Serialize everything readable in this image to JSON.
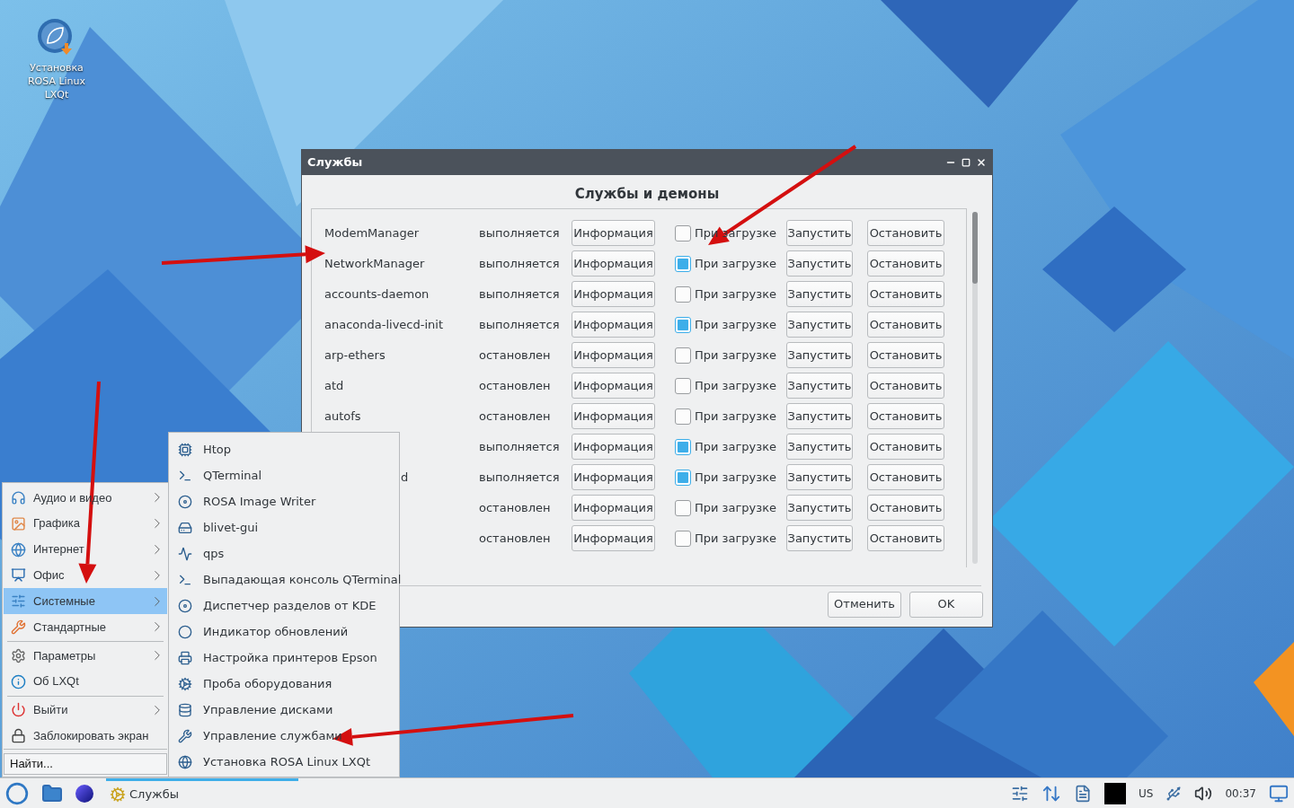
{
  "desktop_icons": [
    {
      "label": "Установка ROSA Linux LXQt"
    }
  ],
  "dialog": {
    "title": "Службы",
    "heading": "Службы и демоны",
    "services": [
      {
        "name": "ModemManager",
        "status": "выполняется",
        "info": "Информация",
        "autostart_label": "При загрузке",
        "autostart": false,
        "start": "Запустить",
        "stop": "Остановить"
      },
      {
        "name": "NetworkManager",
        "status": "выполняется",
        "info": "Информация",
        "autostart_label": "При загрузке",
        "autostart": true,
        "start": "Запустить",
        "stop": "Остановить"
      },
      {
        "name": "accounts-daemon",
        "status": "выполняется",
        "info": "Информация",
        "autostart_label": "При загрузке",
        "autostart": false,
        "start": "Запустить",
        "stop": "Остановить"
      },
      {
        "name": "anaconda-livecd-init",
        "status": "выполняется",
        "info": "Информация",
        "autostart_label": "При загрузке",
        "autostart": true,
        "start": "Запустить",
        "stop": "Остановить"
      },
      {
        "name": "arp-ethers",
        "status": "остановлен",
        "info": "Информация",
        "autostart_label": "При загрузке",
        "autostart": false,
        "start": "Запустить",
        "stop": "Остановить"
      },
      {
        "name": "atd",
        "status": "остановлен",
        "info": "Информация",
        "autostart_label": "При загрузке",
        "autostart": false,
        "start": "Запустить",
        "stop": "Остановить"
      },
      {
        "name": "autofs",
        "status": "остановлен",
        "info": "Информация",
        "autostart_label": "При загрузке",
        "autostart": false,
        "start": "Запустить",
        "stop": "Остановить"
      },
      {
        "status": "выполняется",
        "info": "Информация",
        "autostart_label": "При загрузке",
        "autostart": true,
        "start": "Запустить",
        "stop": "Остановить"
      },
      {
        "name_tail": "d",
        "status": "выполняется",
        "info": "Информация",
        "autostart_label": "При загрузке",
        "autostart": true,
        "start": "Запустить",
        "stop": "Остановить"
      },
      {
        "status": "остановлен",
        "info": "Информация",
        "autostart_label": "При загрузке",
        "autostart": false,
        "start": "Запустить",
        "stop": "Остановить"
      },
      {
        "status": "остановлен",
        "info": "Информация",
        "autostart_label": "При загрузке",
        "autostart": false,
        "start": "Запустить",
        "stop": "Остановить"
      }
    ],
    "buttons": [
      "Отменить",
      "OK"
    ]
  },
  "menu": {
    "items": [
      {
        "kind": "item",
        "label": "Аудио и видео",
        "submenu": true,
        "selected": false
      },
      {
        "kind": "item",
        "label": "Графика",
        "submenu": true,
        "selected": false
      },
      {
        "kind": "item",
        "label": "Интернет",
        "submenu": true,
        "selected": false
      },
      {
        "kind": "item",
        "label": "Офис",
        "submenu": true,
        "selected": false
      },
      {
        "kind": "item",
        "label": "Системные",
        "submenu": true,
        "selected": true
      },
      {
        "kind": "item",
        "label": "Стандартные",
        "submenu": true,
        "selected": false
      },
      {
        "kind": "separator"
      },
      {
        "kind": "item",
        "label": "Параметры",
        "submenu": true,
        "selected": false
      },
      {
        "kind": "item",
        "label": "Об LXQt",
        "submenu": false,
        "selected": false
      },
      {
        "kind": "separator"
      },
      {
        "kind": "item",
        "label": "Выйти",
        "submenu": true,
        "selected": false
      },
      {
        "kind": "item",
        "label": "Заблокировать экран",
        "submenu": false,
        "selected": false
      }
    ],
    "search": "Найти..."
  },
  "submenu": {
    "items": [
      {
        "label": "Htop"
      },
      {
        "label": "QTerminal"
      },
      {
        "label": "ROSA Image Writer"
      },
      {
        "label": "blivet-gui"
      },
      {
        "label": "qps"
      },
      {
        "label": "Выпадающая консоль QTerminal"
      },
      {
        "label": "Диспетчер разделов от KDE"
      },
      {
        "label": "Индикатор обновлений"
      },
      {
        "label": "Настройка принтеров Epson"
      },
      {
        "label": "Проба оборудования"
      },
      {
        "label": "Управление дисками"
      },
      {
        "label": "Управление службами"
      },
      {
        "label": "Установка ROSA Linux LXQt"
      }
    ]
  },
  "taskbar": {
    "tasks": [
      {
        "label": "Службы",
        "selected": true
      }
    ],
    "layout": "US",
    "clock": "00:37"
  }
}
